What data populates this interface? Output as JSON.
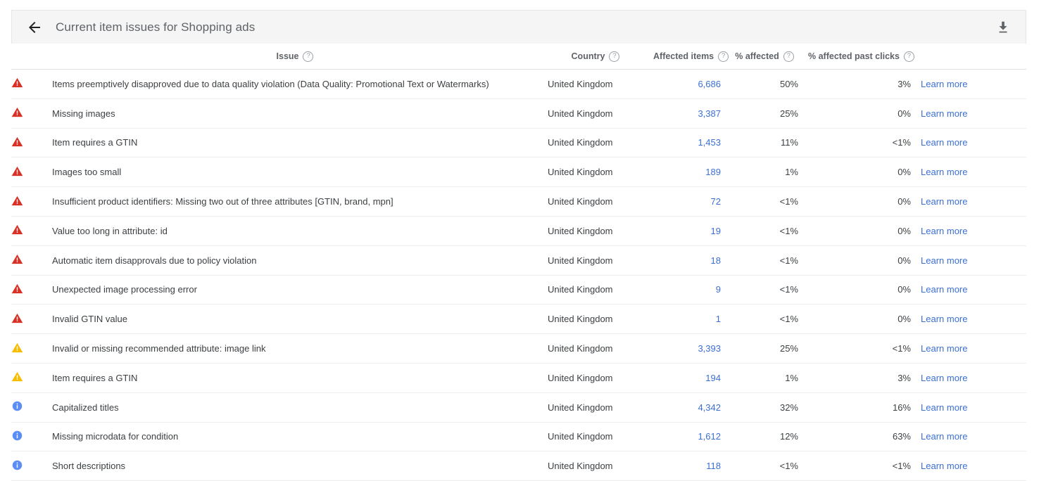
{
  "header": {
    "back_icon": "arrow-back-icon",
    "title": "Current item issues for Shopping ads",
    "download_icon": "download-icon"
  },
  "table": {
    "columns": [
      {
        "key": "severity",
        "label": "",
        "help": false,
        "align": "left"
      },
      {
        "key": "issue",
        "label": "Issue",
        "help": true,
        "align": "left"
      },
      {
        "key": "country",
        "label": "Country",
        "help": true,
        "align": "left"
      },
      {
        "key": "affected_items",
        "label": "Affected items",
        "help": true,
        "align": "right"
      },
      {
        "key": "pct_affected",
        "label": "% affected",
        "help": true,
        "align": "right"
      },
      {
        "key": "pct_affected_past_clicks",
        "label": "% affected past clicks",
        "help": true,
        "align": "right"
      },
      {
        "key": "learn",
        "label": "",
        "help": false,
        "align": "left"
      }
    ],
    "learn_more_label": "Learn more",
    "rows": [
      {
        "severity": "error",
        "issue": "Items preemptively disapproved due to data quality violation (Data Quality: Promotional Text or Watermarks)",
        "country": "United Kingdom",
        "affected_items": "6,686",
        "pct_affected": "50%",
        "pct_affected_past_clicks": "3%",
        "learn": "Learn more"
      },
      {
        "severity": "error",
        "issue": "Missing images",
        "country": "United Kingdom",
        "affected_items": "3,387",
        "pct_affected": "25%",
        "pct_affected_past_clicks": "0%",
        "learn": "Learn more"
      },
      {
        "severity": "error",
        "issue": "Item requires a GTIN",
        "country": "United Kingdom",
        "affected_items": "1,453",
        "pct_affected": "11%",
        "pct_affected_past_clicks": "<1%",
        "learn": "Learn more"
      },
      {
        "severity": "error",
        "issue": "Images too small",
        "country": "United Kingdom",
        "affected_items": "189",
        "pct_affected": "1%",
        "pct_affected_past_clicks": "0%",
        "learn": "Learn more"
      },
      {
        "severity": "error",
        "issue": "Insufficient product identifiers: Missing two out of three attributes [GTIN, brand, mpn]",
        "country": "United Kingdom",
        "affected_items": "72",
        "pct_affected": "<1%",
        "pct_affected_past_clicks": "0%",
        "learn": "Learn more"
      },
      {
        "severity": "error",
        "issue": "Value too long in attribute: id",
        "country": "United Kingdom",
        "affected_items": "19",
        "pct_affected": "<1%",
        "pct_affected_past_clicks": "0%",
        "learn": "Learn more"
      },
      {
        "severity": "error",
        "issue": "Automatic item disapprovals due to policy violation",
        "country": "United Kingdom",
        "affected_items": "18",
        "pct_affected": "<1%",
        "pct_affected_past_clicks": "0%",
        "learn": "Learn more"
      },
      {
        "severity": "error",
        "issue": "Unexpected image processing error",
        "country": "United Kingdom",
        "affected_items": "9",
        "pct_affected": "<1%",
        "pct_affected_past_clicks": "0%",
        "learn": "Learn more"
      },
      {
        "severity": "error",
        "issue": "Invalid GTIN value",
        "country": "United Kingdom",
        "affected_items": "1",
        "pct_affected": "<1%",
        "pct_affected_past_clicks": "0%",
        "learn": "Learn more"
      },
      {
        "severity": "warning",
        "issue": "Invalid or missing recommended attribute: image link",
        "country": "United Kingdom",
        "affected_items": "3,393",
        "pct_affected": "25%",
        "pct_affected_past_clicks": "<1%",
        "learn": "Learn more"
      },
      {
        "severity": "warning",
        "issue": "Item requires a GTIN",
        "country": "United Kingdom",
        "affected_items": "194",
        "pct_affected": "1%",
        "pct_affected_past_clicks": "3%",
        "learn": "Learn more"
      },
      {
        "severity": "info",
        "issue": "Capitalized titles",
        "country": "United Kingdom",
        "affected_items": "4,342",
        "pct_affected": "32%",
        "pct_affected_past_clicks": "16%",
        "learn": "Learn more"
      },
      {
        "severity": "info",
        "issue": "Missing microdata for condition",
        "country": "United Kingdom",
        "affected_items": "1,612",
        "pct_affected": "12%",
        "pct_affected_past_clicks": "63%",
        "learn": "Learn more"
      },
      {
        "severity": "info",
        "issue": "Short descriptions",
        "country": "United Kingdom",
        "affected_items": "118",
        "pct_affected": "<1%",
        "pct_affected_past_clicks": "<1%",
        "learn": "Learn more"
      }
    ]
  },
  "colors": {
    "error": "#d93025",
    "warning": "#f5bc00",
    "info": "#5b8df6",
    "link": "#3b6fd4",
    "header_bg": "#f5f5f5",
    "text": "#3c4043",
    "muted": "#5f6368"
  },
  "severity_icon_names": {
    "error": "error-triangle-icon",
    "warning": "warning-triangle-icon",
    "info": "info-circle-icon"
  }
}
